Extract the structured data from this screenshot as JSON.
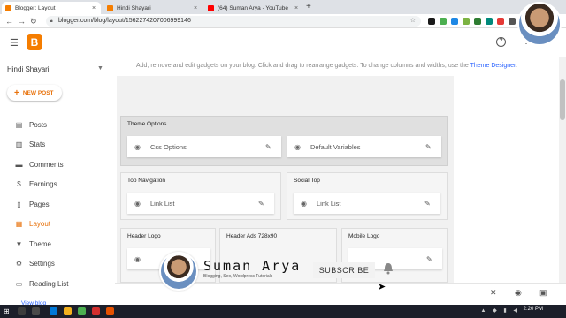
{
  "browser": {
    "tabs": [
      {
        "title": "Blogger: Layout",
        "active": true,
        "favicon_color": "#f57d00"
      },
      {
        "title": "Hindi Shayari",
        "active": false,
        "favicon_color": "#f57d00"
      },
      {
        "title": "(64) Suman Arya - YouTube",
        "active": false,
        "favicon_color": "#ff0000"
      }
    ],
    "url": "blogger.com/blog/layout/1562274207006999146",
    "close_glyph": "×",
    "new_tab_glyph": "+"
  },
  "header": {
    "menu_icon": "hamburger-icon",
    "logo_letter": "B",
    "help_glyph": "?"
  },
  "sidebar": {
    "blog_name": "Hindi Shayari",
    "new_post_label": "NEW POST",
    "items": [
      {
        "label": "Posts",
        "icon": "posts-icon",
        "glyph": "▤",
        "active": false
      },
      {
        "label": "Stats",
        "icon": "stats-icon",
        "glyph": "▥",
        "active": false
      },
      {
        "label": "Comments",
        "icon": "comments-icon",
        "glyph": "▬",
        "active": false
      },
      {
        "label": "Earnings",
        "icon": "earnings-icon",
        "glyph": "$",
        "active": false
      },
      {
        "label": "Pages",
        "icon": "pages-icon",
        "glyph": "▯",
        "active": false
      },
      {
        "label": "Layout",
        "icon": "layout-icon",
        "glyph": "▦",
        "active": true
      },
      {
        "label": "Theme",
        "icon": "theme-icon",
        "glyph": "▼",
        "active": false
      },
      {
        "label": "Settings",
        "icon": "settings-icon",
        "glyph": "⚙",
        "active": false
      },
      {
        "label": "Reading List",
        "icon": "reading-list-icon",
        "glyph": "▭",
        "active": false
      }
    ],
    "view_blog_label": "View blog"
  },
  "main": {
    "hint_text": "Add, remove and edit gadgets on your blog. Click and drag to rearrange gadgets. To change columns and widths, use the ",
    "hint_link": "Theme Designer",
    "hint_end": ".",
    "sections": {
      "theme_options": {
        "title": "Theme Options",
        "gadgets": [
          "Css Options",
          "Default Variables"
        ]
      },
      "top_navigation": {
        "title": "Top Navigation",
        "gadgets": [
          "Link List"
        ]
      },
      "social_top": {
        "title": "Social Top",
        "gadgets": [
          "Link List"
        ]
      },
      "header_logo": {
        "title": "Header Logo"
      },
      "header_ads": {
        "title": "Header Ads 728x90"
      },
      "mobile_logo": {
        "title": "Mobile Logo"
      }
    }
  },
  "overlay": {
    "channel_name": "Suman Arya",
    "tagline": "Blogging, Seo, Wordpress Tutorials",
    "subscribe_label": "SUBSCRIBE"
  },
  "taskbar": {
    "time": "2:20 PM"
  },
  "colors": {
    "accent": "#e8710a",
    "link": "#2962ff"
  }
}
